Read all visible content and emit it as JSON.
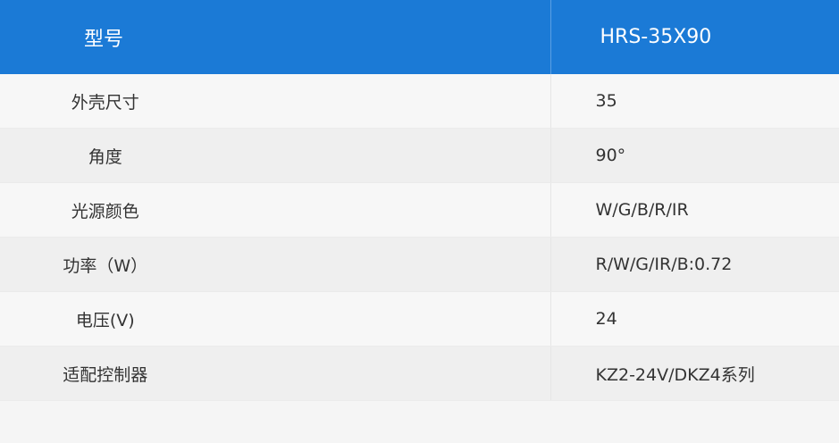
{
  "header": {
    "label": "型号",
    "value": "HRS-35X90"
  },
  "rows": [
    {
      "label": "外壳尺寸",
      "value": "35"
    },
    {
      "label": "角度",
      "value": "90°"
    },
    {
      "label": "光源颜色",
      "value": "W/G/B/R/IR"
    },
    {
      "label": "功率（W）",
      "value": "R/W/G/IR/B:0.72"
    },
    {
      "label": "电压(V)",
      "value": "24"
    },
    {
      "label": "适配控制器",
      "value": "KZ2-24V/DKZ4系列"
    }
  ],
  "colors": {
    "header_bg": "#1b7ad6",
    "header_text": "#ffffff",
    "row_odd": "#f7f7f7",
    "row_even": "#efefef",
    "text": "#333333"
  }
}
